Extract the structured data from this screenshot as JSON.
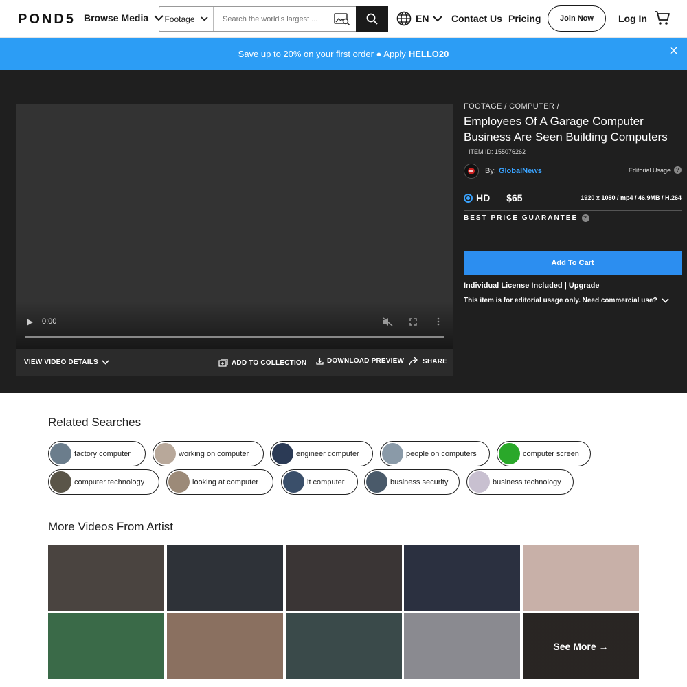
{
  "header": {
    "logo": "POND5",
    "browse_media": "Browse Media",
    "search_category": "Footage",
    "search_placeholder": "Search the world's largest ...",
    "language": "EN",
    "contact": "Contact Us",
    "pricing": "Pricing",
    "join": "Join Now",
    "login": "Log In"
  },
  "promo": {
    "text": "Save up to 20% on your first order ● Apply",
    "code": "HELLO20"
  },
  "player": {
    "time": "0:00",
    "progress": 0
  },
  "player_bar": {
    "details": "VIEW VIDEO DETAILS",
    "add_collection": "ADD TO COLLECTION",
    "download": "DOWNLOAD PREVIEW",
    "share": "SHARE"
  },
  "item": {
    "breadcrumb_1": "FOOTAGE",
    "breadcrumb_2": "COMPUTER",
    "title": "Employees Of A Garage Computer Business Are Seen Building Computers",
    "item_id": "ITEM ID: 155076262",
    "by": "By:",
    "artist": "GlobalNews",
    "usage": "Editorial Usage",
    "format": "HD",
    "price": "$65",
    "specs": "1920 x 1080 / mp4 / 46.9MB / H.264",
    "guarantee": "BEST PRICE GUARANTEE",
    "add_to_cart": "Add To Cart",
    "license": "Individual License Included",
    "upgrade": "Upgrade",
    "editorial_note": "This item is for editorial usage only. Need commercial use?"
  },
  "related": {
    "title": "Related Searches",
    "chips": [
      {
        "label": "factory computer",
        "color": "#6b7d8c"
      },
      {
        "label": "working on computer",
        "color": "#b8a89a"
      },
      {
        "label": "engineer computer",
        "color": "#2b3a55"
      },
      {
        "label": "people on computers",
        "color": "#8a9aa8"
      },
      {
        "label": "computer screen",
        "color": "#2aa82a"
      },
      {
        "label": "computer technology",
        "color": "#5a5548"
      },
      {
        "label": "looking at computer",
        "color": "#9c8a78"
      },
      {
        "label": "it computer",
        "color": "#3a4f6a"
      },
      {
        "label": "business security",
        "color": "#4a5a6a"
      },
      {
        "label": "business technology",
        "color": "#c8c0d0"
      }
    ]
  },
  "more_videos": {
    "title": "More Videos From Artist",
    "see_more": "See More →",
    "thumb_colors": [
      "#4a4440",
      "#2e3238",
      "#3a3535",
      "#2b3040",
      "#c8b0a8",
      "#3a6a48",
      "#8a7060",
      "#3a4a4a",
      "#8a8a90",
      "#4a4440"
    ]
  }
}
